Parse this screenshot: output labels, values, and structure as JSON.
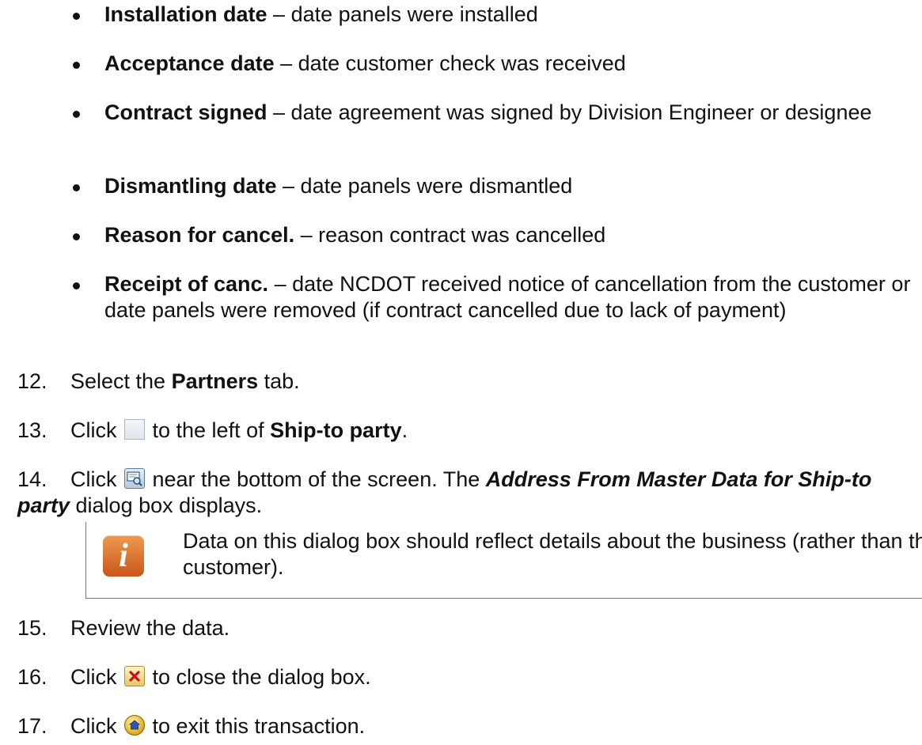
{
  "bullets": [
    {
      "term": "Installation date",
      "desc": " – date panels were installed"
    },
    {
      "term": "Acceptance date",
      "desc": " – date customer check was received"
    },
    {
      "term": "Contract signed",
      "desc": " – date agreement was signed by Division Engineer or designee"
    },
    {
      "term": "Dismantling date",
      "desc": " – date panels were dismantled"
    },
    {
      "term": "Reason for cancel.",
      "desc": " – reason contract was cancelled"
    },
    {
      "term": "Receipt of canc.",
      "desc": " – date NCDOT received notice of cancellation from the customer or date panels were removed (if contract cancelled due to lack of payment)"
    }
  ],
  "steps": {
    "s12": {
      "num": "12.",
      "pre": "Select the ",
      "bold": "Partners",
      "post": " tab."
    },
    "s13": {
      "num": "13.",
      "pre": "Click ",
      "mid": " to the left of ",
      "bold": "Ship-to party",
      "post": ".",
      "icon": "blank-button-icon"
    },
    "s14": {
      "num": "14.",
      "pre": "Click ",
      "mid": " near the bottom of the screen. The ",
      "bold_italic": "Address From Master Data for Ship-to party",
      "post": " dialog box displays.",
      "icon": "display-address-icon"
    },
    "s15": {
      "num": "15.",
      "text": "Review the data."
    },
    "s16": {
      "num": "16.",
      "pre": "Click ",
      "post": " to close the dialog box.",
      "icon": "close-icon"
    },
    "s17": {
      "num": "17.",
      "pre": "Click ",
      "post": " to exit this transaction.",
      "icon": "exit-icon"
    }
  },
  "note": {
    "icon": "info-icon",
    "glyph": "i",
    "text": "Data on this dialog box should reflect details about the business (rather than the customer)."
  },
  "colors": {
    "text": "#111111",
    "note_icon": "#d96a25",
    "note_border": "#777777"
  }
}
